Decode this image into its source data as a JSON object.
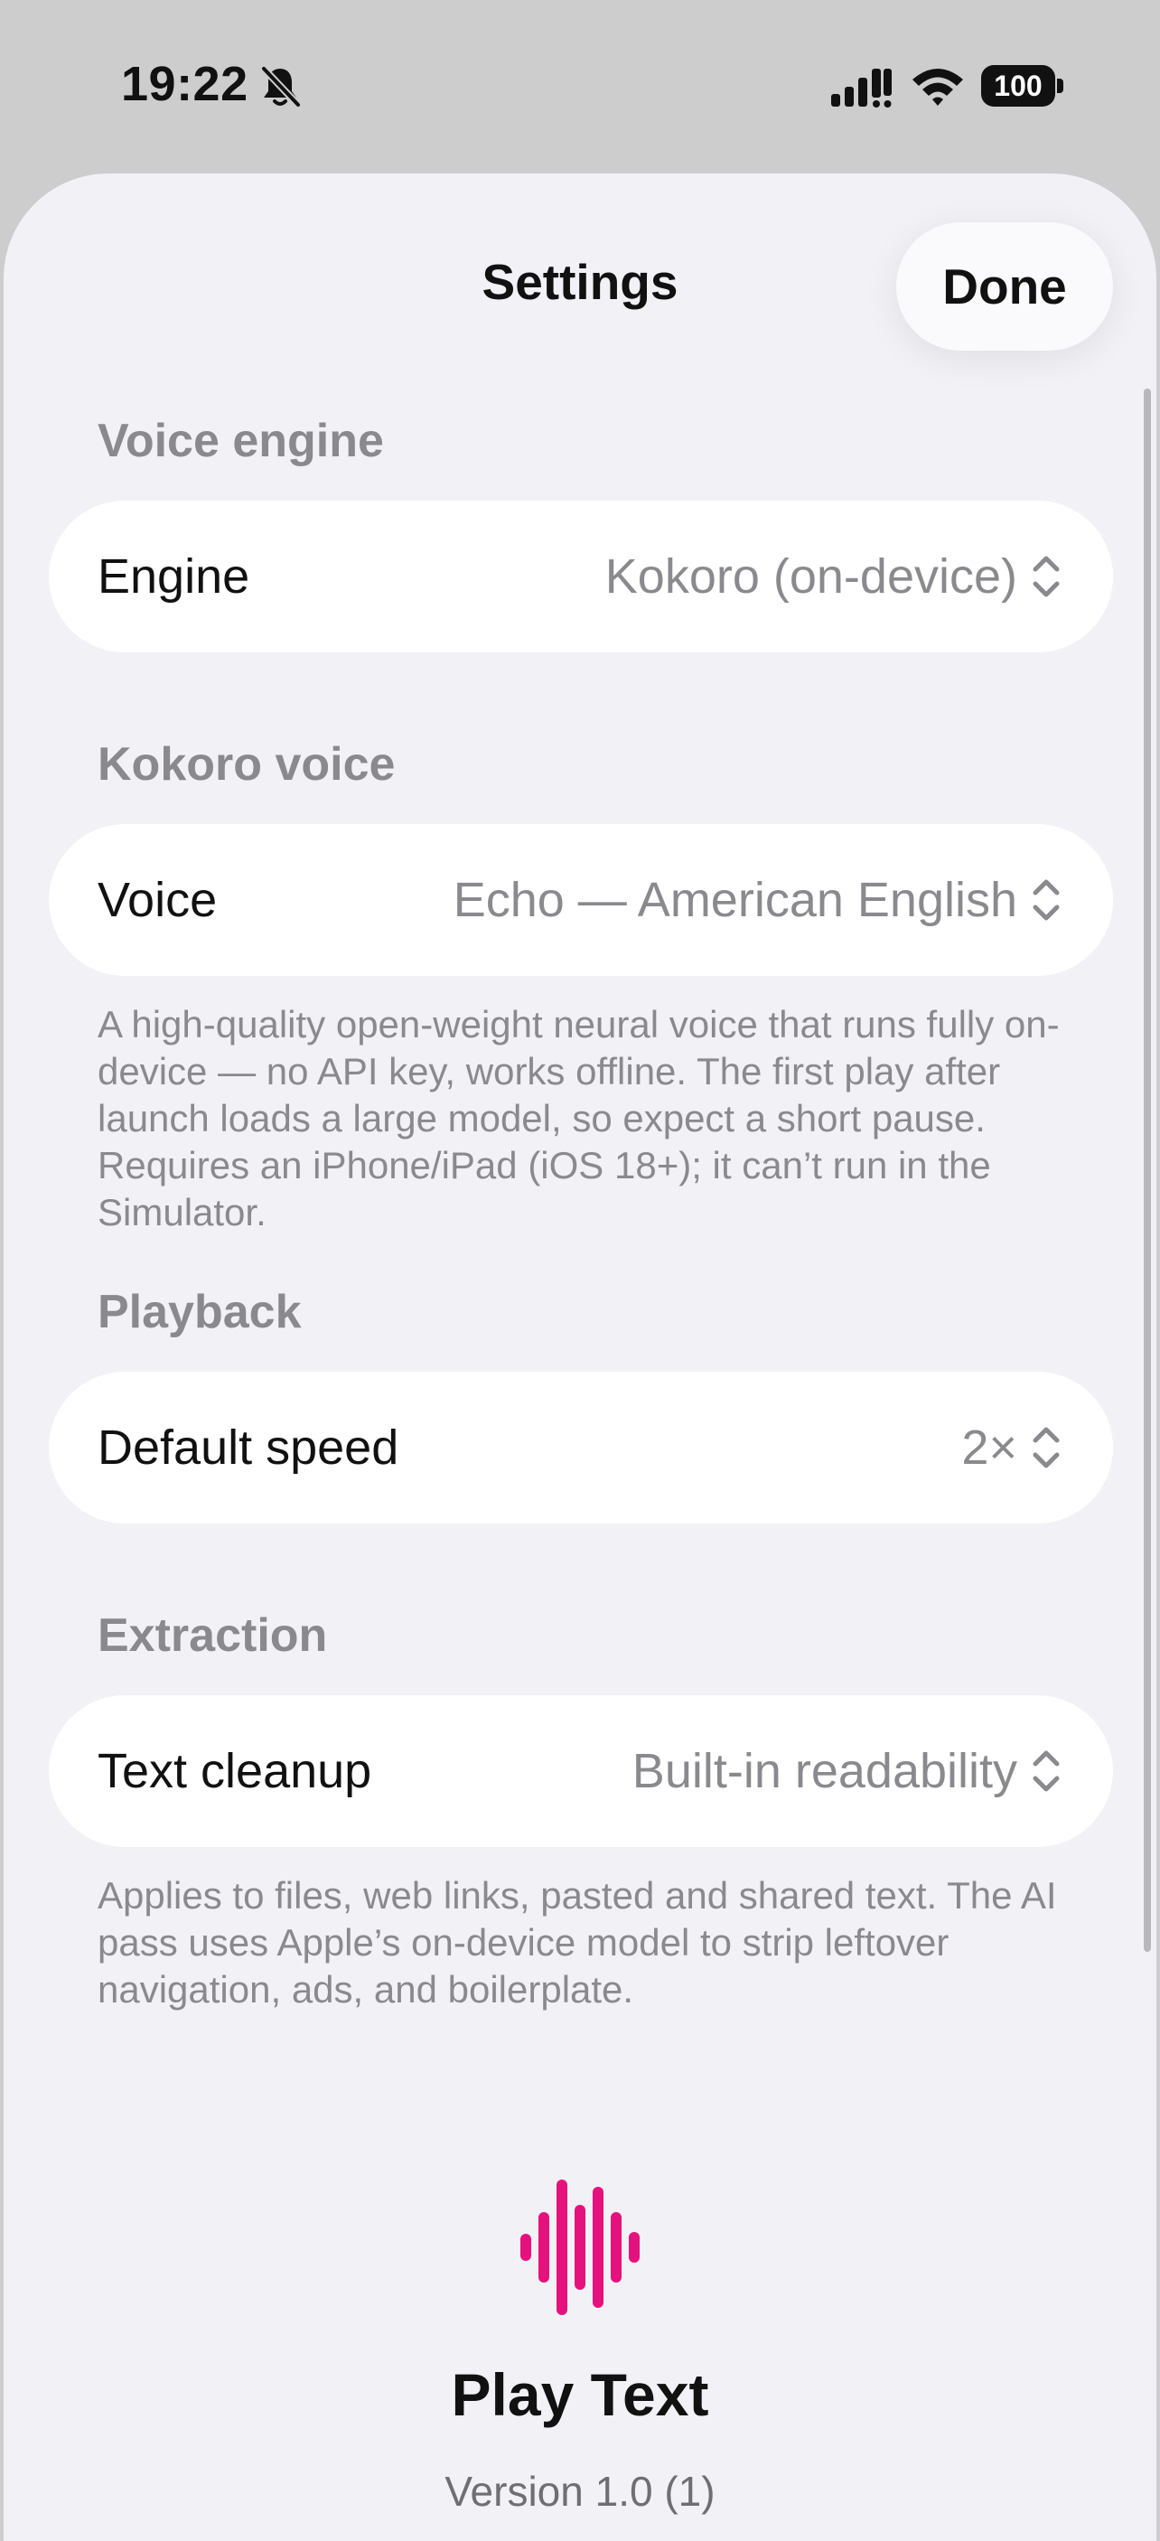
{
  "status_bar": {
    "time": "19:22",
    "battery": "100",
    "icons": [
      "bell-slash-icon",
      "cellular-signal-icon",
      "wifi-icon",
      "battery-icon"
    ]
  },
  "header": {
    "title": "Settings",
    "done_label": "Done"
  },
  "sections": {
    "voice_engine": {
      "header": "Voice engine",
      "engine_label": "Engine",
      "engine_value": "Kokoro (on-device)"
    },
    "kokoro_voice": {
      "header": "Kokoro voice",
      "voice_label": "Voice",
      "voice_value": "Echo — American English",
      "footnote": "A high-quality open-weight neural voice that runs fully on-device — no API key, works offline. The first play after launch loads a large model, so expect a short pause. Requires an iPhone/iPad (iOS 18+); it can’t run in the Simulator."
    },
    "playback": {
      "header": "Playback",
      "speed_label": "Default speed",
      "speed_value": "2×"
    },
    "extraction": {
      "header": "Extraction",
      "cleanup_label": "Text cleanup",
      "cleanup_value": "Built-in readability",
      "footnote": "Applies to files, web links, pasted and shared text. The AI pass uses Apple’s on-device model to strip leftover navigation, ads, and boilerplate."
    }
  },
  "about": {
    "app_name": "Play Text",
    "version": "Version 1.0 (1)",
    "logo_icon": "waveform-icon",
    "accent_color": "#e5127d"
  }
}
